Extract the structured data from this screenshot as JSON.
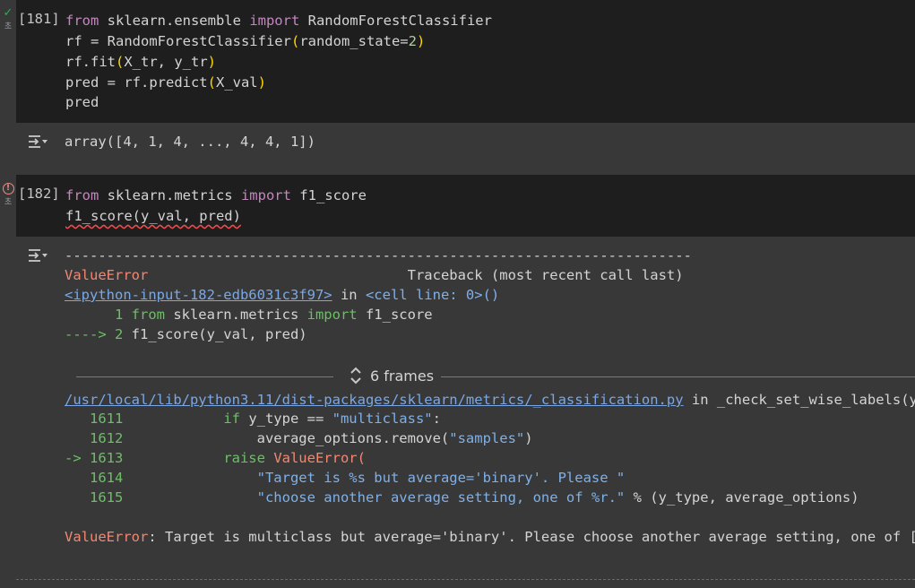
{
  "cell1": {
    "exec": "[181]",
    "status_text": "초",
    "lines": [
      [
        "from",
        " sklearn.ensemble ",
        "import",
        " RandomForestClassifier"
      ],
      [
        "rf = RandomForestClassifier(random_state=2)"
      ],
      [
        "rf.fit(X_tr, y_tr)"
      ],
      [
        "pred = rf.predict(X_val)"
      ],
      [
        "pred"
      ]
    ],
    "output": "array([4, 1, 4, ..., 4, 4, 1])"
  },
  "cell2": {
    "exec": "[182]",
    "status_text": "초",
    "line1": {
      "kw1": "from",
      "mod": " sklearn.metrics ",
      "kw2": "import",
      "name": " f1_score"
    },
    "line2": "f1_score(y_val, pred)"
  },
  "traceback": {
    "dashes": "---------------------------------------------------------------------------",
    "error_name": "ValueError",
    "tb_header": "                               Traceback (most recent call last)",
    "input_link": "<ipython-input-182-edb6031c3f97>",
    "in_text": " in ",
    "cell_line": "<cell line: 0>()",
    "l1_num": "      1 ",
    "l1_kw1": "from",
    "l1_mod": " sklearn.metrics ",
    "l1_kw2": "import",
    "l1_name": " f1_score",
    "l2_arrow": "----> 2 ",
    "l2_code": "f1_score(y_val, pred)",
    "frames_label": "6 frames",
    "file_link": "/usr/local/lib/python3.11/dist-packages/sklearn/metrics/_classification.py",
    "file_in": " in _check_set_wise_labels(y_true",
    "src": [
      {
        "no": "   1611 ",
        "pre": "           ",
        "kw": "if",
        "code": " y_type == ",
        "str": "\"multiclass\"",
        "post": ":"
      },
      {
        "no": "   1612 ",
        "pre": "               average_options.remove(",
        "kw": "",
        "code": "",
        "str": "\"samples\"",
        "post": ")"
      },
      {
        "no": "-> 1613 ",
        "pre": "           ",
        "kw": "raise",
        "code": " ValueError(",
        "str": "",
        "post": ""
      },
      {
        "no": "   1614 ",
        "pre": "               ",
        "kw": "",
        "code": "",
        "str": "\"Target is %s but average='binary'. Please \"",
        "post": ""
      },
      {
        "no": "   1615 ",
        "pre": "               ",
        "kw": "",
        "code": "",
        "str": "\"choose another average setting, one of %r.\"",
        "post": " % (y_type, average_options)"
      }
    ],
    "final_error_name": "ValueError",
    "final_message": ": Target is multiclass but average='binary'. Please choose another average setting, one of [None"
  }
}
